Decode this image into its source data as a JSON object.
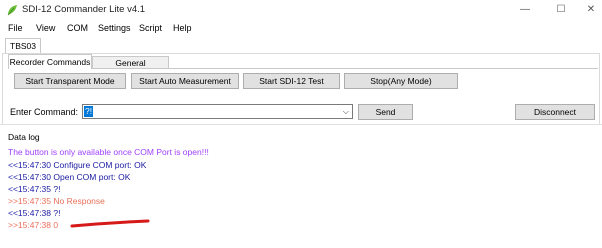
{
  "window": {
    "title": "SDI-12 Commander Lite v4.1",
    "controls": {
      "minimize": "—",
      "maximize": "☐",
      "close": "✕"
    }
  },
  "menu": [
    "File",
    "View",
    "COM",
    "Settings",
    "Script",
    "Help"
  ],
  "device_tab": "TBS03",
  "tabs": {
    "active": "Recorder Commands",
    "inactive": "General Commands"
  },
  "buttons": {
    "transparent": "Start Transparent Mode",
    "auto_measurement": "Start Auto Measurement",
    "sdi12_test": "Start SDI-12 Test",
    "stop": "Stop(Any Mode)",
    "send": "Send",
    "disconnect": "Disconnect"
  },
  "command": {
    "label": "Enter Command:",
    "value": "?!"
  },
  "log": {
    "title": "Data log",
    "lines": [
      {
        "text": "The button is only available once COM Port is open!!!",
        "color": "#a040ff"
      },
      {
        "text": "<<15:47:30 Configure COM port: OK",
        "color": "#1a1aa0"
      },
      {
        "text": "<<15:47:30 Open COM port: OK",
        "color": "#1a1aa0"
      },
      {
        "text": "<<15:47:35 ?!",
        "color": "#1a1aa0"
      },
      {
        "text": ">>15:47:35 No Response",
        "color": "#e8705a"
      },
      {
        "text": "<<15:47:38 ?!",
        "color": "#1a1aa0"
      },
      {
        "text": ">>15:47:38 0",
        "color": "#e8705a"
      }
    ]
  }
}
